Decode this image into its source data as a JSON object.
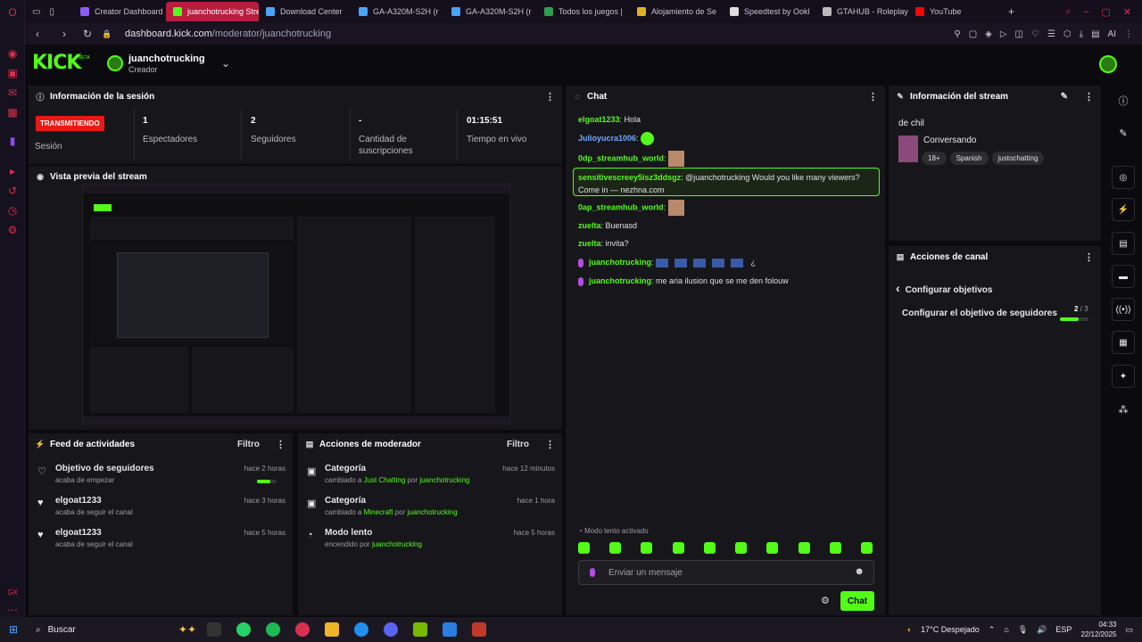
{
  "browser": {
    "tabs": [
      {
        "label": "Creator Dashboard",
        "color": "#8b5cf6"
      },
      {
        "label": "juanchotrucking Stream",
        "color": "#53fc18",
        "active": true
      },
      {
        "label": "Download Center",
        "color": "#4aa3ff"
      },
      {
        "label": "GA-A320M-S2H (r",
        "color": "#4aa3ff"
      },
      {
        "label": "GA-A320M-S2H (r",
        "color": "#4aa3ff"
      },
      {
        "label": "Todos los juegos |",
        "color": "#2e9e4f"
      },
      {
        "label": "Alojamiento de Se",
        "color": "#e0b020"
      },
      {
        "label": "Speedtest by Ookl",
        "color": "#dddddd"
      },
      {
        "label": "GTAHUB - Roleplay",
        "color": "#bbbbbb"
      },
      {
        "label": "YouTube",
        "color": "#ff0000"
      }
    ],
    "url_domain": "dashboard.kick.com",
    "url_path": "/moderator/juanchotrucking"
  },
  "header": {
    "logo": "KICK",
    "logo_badge": "BETA",
    "channel_name": "juanchotrucking",
    "channel_role": "Creador"
  },
  "session": {
    "title": "Información de la sesión",
    "live_badge": "TRANSMITIENDO",
    "live_label": "Sesión",
    "stats": [
      {
        "value": "1",
        "label": "Espectadores"
      },
      {
        "value": "2",
        "label": "Seguidores"
      },
      {
        "value": "-",
        "label": "Cantidad de suscripciones"
      },
      {
        "value": "01:15:51",
        "label": "Tiempo en vivo"
      }
    ]
  },
  "preview": {
    "title": "Vista previa del stream"
  },
  "feed": {
    "title": "Feed de actividades",
    "filter": "Filtro",
    "items": [
      {
        "title": "Objetivo de seguidores",
        "sub": "acaba de empezar",
        "time": "hace 2 horas",
        "progress": 0.7
      },
      {
        "title": "elgoat1233",
        "sub": "acaba de seguir el canal",
        "time": "hace 3 horas"
      },
      {
        "title": "elgoat1233",
        "sub": "acaba de seguir el canal",
        "time": "hace 5 horas"
      }
    ]
  },
  "mod_actions": {
    "title": "Acciones de moderador",
    "filter": "Filtro",
    "items": [
      {
        "title": "Categoría",
        "pre": "cambiado a",
        "what": "Just Chatting",
        "por": "por",
        "who": "juanchotrucking",
        "time": "hace 12 minutos"
      },
      {
        "title": "Categoría",
        "pre": "cambiado a",
        "what": "Minecraft",
        "por": "por",
        "who": "juanchotrucking",
        "time": "hace 1 hora"
      },
      {
        "title": "Modo lento",
        "pre": "encendido",
        "what": "",
        "por": "por",
        "who": "juanchotrucking",
        "time": "hace 5 horas"
      }
    ]
  },
  "chat": {
    "title": "Chat",
    "messages": [
      {
        "user": "elgoat1233",
        "text": "Hola"
      },
      {
        "user": "Julioyucra1006",
        "text": ""
      },
      {
        "user": "0dp_streamhub_world",
        "text": ""
      },
      {
        "user": "sensitivescreey5isz3ddsgz",
        "text": "@juanchotrucking Would you like many viewers?",
        "text2": "Come in — nezhna.com"
      },
      {
        "user": "0ap_streamhub_world",
        "text": ""
      },
      {
        "user": "zuelta",
        "text": "Buenasd"
      },
      {
        "user": "zuelta",
        "text": "invita?"
      },
      {
        "user": "juanchotrucking",
        "text": "¿"
      },
      {
        "user": "juanchotrucking",
        "text": "me aria ilusion que se me den folouw"
      }
    ],
    "slow_mode": "Modo lento activado",
    "input_placeholder": "Enviar un mensaje",
    "send_label": "Chat"
  },
  "stream_info": {
    "title": "Información del stream",
    "stream_title": "de chil",
    "category": "Conversando",
    "tags": [
      "18+",
      "Spanish",
      "justochatting"
    ]
  },
  "channel_actions": {
    "title": "Acciones de canal",
    "back_label": "Configurar objetivos",
    "goal_label": "Configurar el objetivo de seguidores",
    "goal_current": "2",
    "goal_sep": "/",
    "goal_total": "3",
    "goal_progress": 0.67
  },
  "taskbar": {
    "search": "Buscar",
    "weather": "17°C Despejado",
    "lang": "ESP",
    "time": "04:33",
    "date": "22/12/2025"
  },
  "colors": {
    "accent": "#53fc18",
    "live": "#e91916",
    "bg": "#0b0b0f",
    "panel": "#17171b"
  }
}
